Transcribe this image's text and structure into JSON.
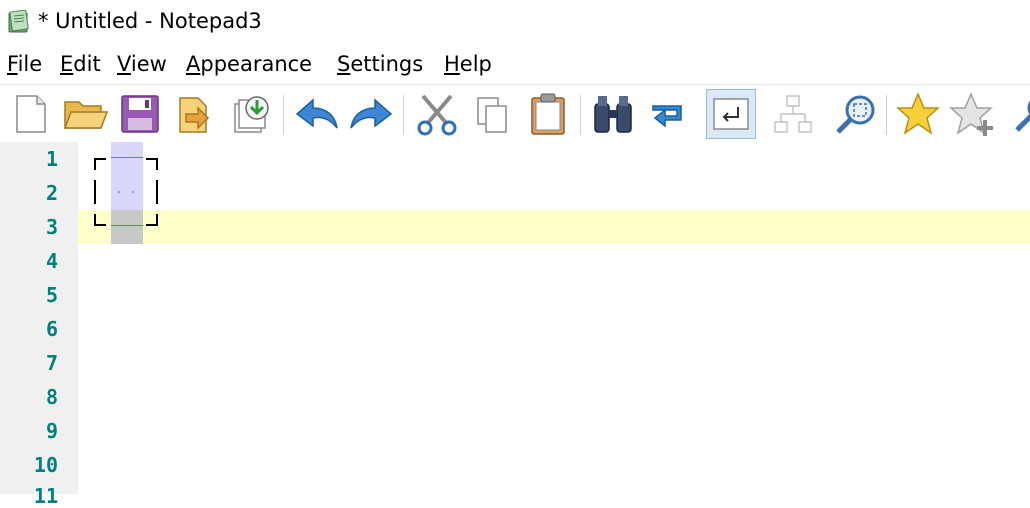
{
  "window": {
    "title": "* Untitled - Notepad3"
  },
  "menu": [
    {
      "label": "File",
      "accel": "F",
      "rest": "ile"
    },
    {
      "label": "Edit",
      "accel": "E",
      "rest": "dit"
    },
    {
      "label": "View",
      "accel": "V",
      "rest": "iew"
    },
    {
      "label": "Appearance",
      "accel": "A",
      "rest": "ppearance"
    },
    {
      "label": "Settings",
      "accel": "S",
      "rest": "ettings"
    },
    {
      "label": "Help",
      "accel": "H",
      "rest": "elp"
    }
  ],
  "toolbar": {
    "buttons": [
      {
        "name": "new-file",
        "icon": "new-file-icon"
      },
      {
        "name": "open-file",
        "icon": "open-folder-icon"
      },
      {
        "name": "save",
        "icon": "save-disk-icon"
      },
      {
        "name": "save-as",
        "icon": "save-as-icon"
      },
      {
        "name": "reload",
        "icon": "reload-icon"
      },
      {
        "name": "undo",
        "icon": "undo-arrow-icon"
      },
      {
        "name": "redo",
        "icon": "redo-arrow-icon"
      },
      {
        "name": "cut",
        "icon": "scissors-icon"
      },
      {
        "name": "copy",
        "icon": "copy-icon"
      },
      {
        "name": "paste",
        "icon": "clipboard-icon"
      },
      {
        "name": "find",
        "icon": "binoculars-icon"
      },
      {
        "name": "replace",
        "icon": "replace-icon"
      },
      {
        "name": "word-wrap",
        "icon": "word-wrap-icon",
        "active": true
      },
      {
        "name": "fold",
        "icon": "tree-icon",
        "disabled": true
      },
      {
        "name": "zoom",
        "icon": "magnifier-icon"
      },
      {
        "name": "favorites",
        "icon": "star-icon"
      },
      {
        "name": "add-favorite",
        "icon": "star-add-icon"
      },
      {
        "name": "more",
        "icon": "search-partial-icon"
      }
    ]
  },
  "editor": {
    "line_numbers": [
      "1",
      "2",
      "3",
      "4",
      "5",
      "6",
      "7",
      "8",
      "9",
      "10",
      "11"
    ],
    "current_line": 3
  },
  "colors": {
    "gutter_bg": "#f0f0f0",
    "line_number": "#008080",
    "current_line_bg": "#ffffcc",
    "column_highlight": "#d8d8ff"
  }
}
